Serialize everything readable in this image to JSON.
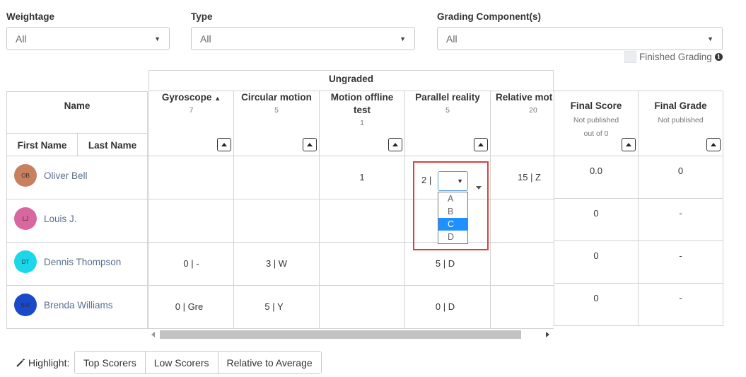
{
  "filters": {
    "weightage": {
      "label": "Weightage",
      "value": "All"
    },
    "type": {
      "label": "Type",
      "value": "All"
    },
    "component": {
      "label": "Grading Component(s)",
      "value": "All"
    }
  },
  "finished_grading": "Finished Grading",
  "ungraded_label": "Ungraded",
  "name_header": "Name",
  "first_name_header": "First Name",
  "last_name_header": "Last Name",
  "columns": [
    {
      "title": "Gyroscope",
      "sort": "▲",
      "count": "7"
    },
    {
      "title": "Circular motion",
      "count": "5"
    },
    {
      "title": "Motion offline",
      "title2": "test",
      "count": "1"
    },
    {
      "title": "Parallel reality",
      "count": "5"
    },
    {
      "title": "Relative mot",
      "count": "20"
    }
  ],
  "final_score": {
    "title": "Final Score",
    "sub1": "Not published",
    "sub2": "out of 0"
  },
  "final_grade": {
    "title": "Final Grade",
    "sub1": "Not published"
  },
  "students": [
    {
      "initials": "OB",
      "name": "Oliver Bell",
      "color": "#c9805e",
      "cells": [
        "",
        "",
        "1",
        "2 |",
        "15 | Z"
      ],
      "score": "0.0",
      "grade": "0"
    },
    {
      "initials": "LJ",
      "name": "Louis J.",
      "color": "#d9679f",
      "cells": [
        "",
        "",
        "",
        "",
        ""
      ],
      "score": "0",
      "grade": "-"
    },
    {
      "initials": "DT",
      "name": "Dennis Thompson",
      "color": "#1ad7ea",
      "cells": [
        "0 | -",
        "3 | W",
        "",
        "5 | D",
        ""
      ],
      "score": "0",
      "grade": "-"
    },
    {
      "initials": "BW",
      "name": "Brenda Williams",
      "color": "#1a49c9",
      "cells": [
        "0 | Gre",
        "5 | Y",
        "",
        "0 | D",
        ""
      ],
      "score": "0",
      "grade": "-"
    }
  ],
  "dropdown": {
    "options": [
      "A",
      "B",
      "C",
      "D"
    ],
    "highlighted": "C"
  },
  "highlight": {
    "label": "Highlight:",
    "buttons": [
      "Top Scorers",
      "Low Scorers",
      "Relative to Average"
    ]
  },
  "icons": {
    "wand": "magic-wand-icon",
    "info": "info-icon",
    "caret": "caret-down-icon",
    "sort": "sort-up-icon"
  }
}
